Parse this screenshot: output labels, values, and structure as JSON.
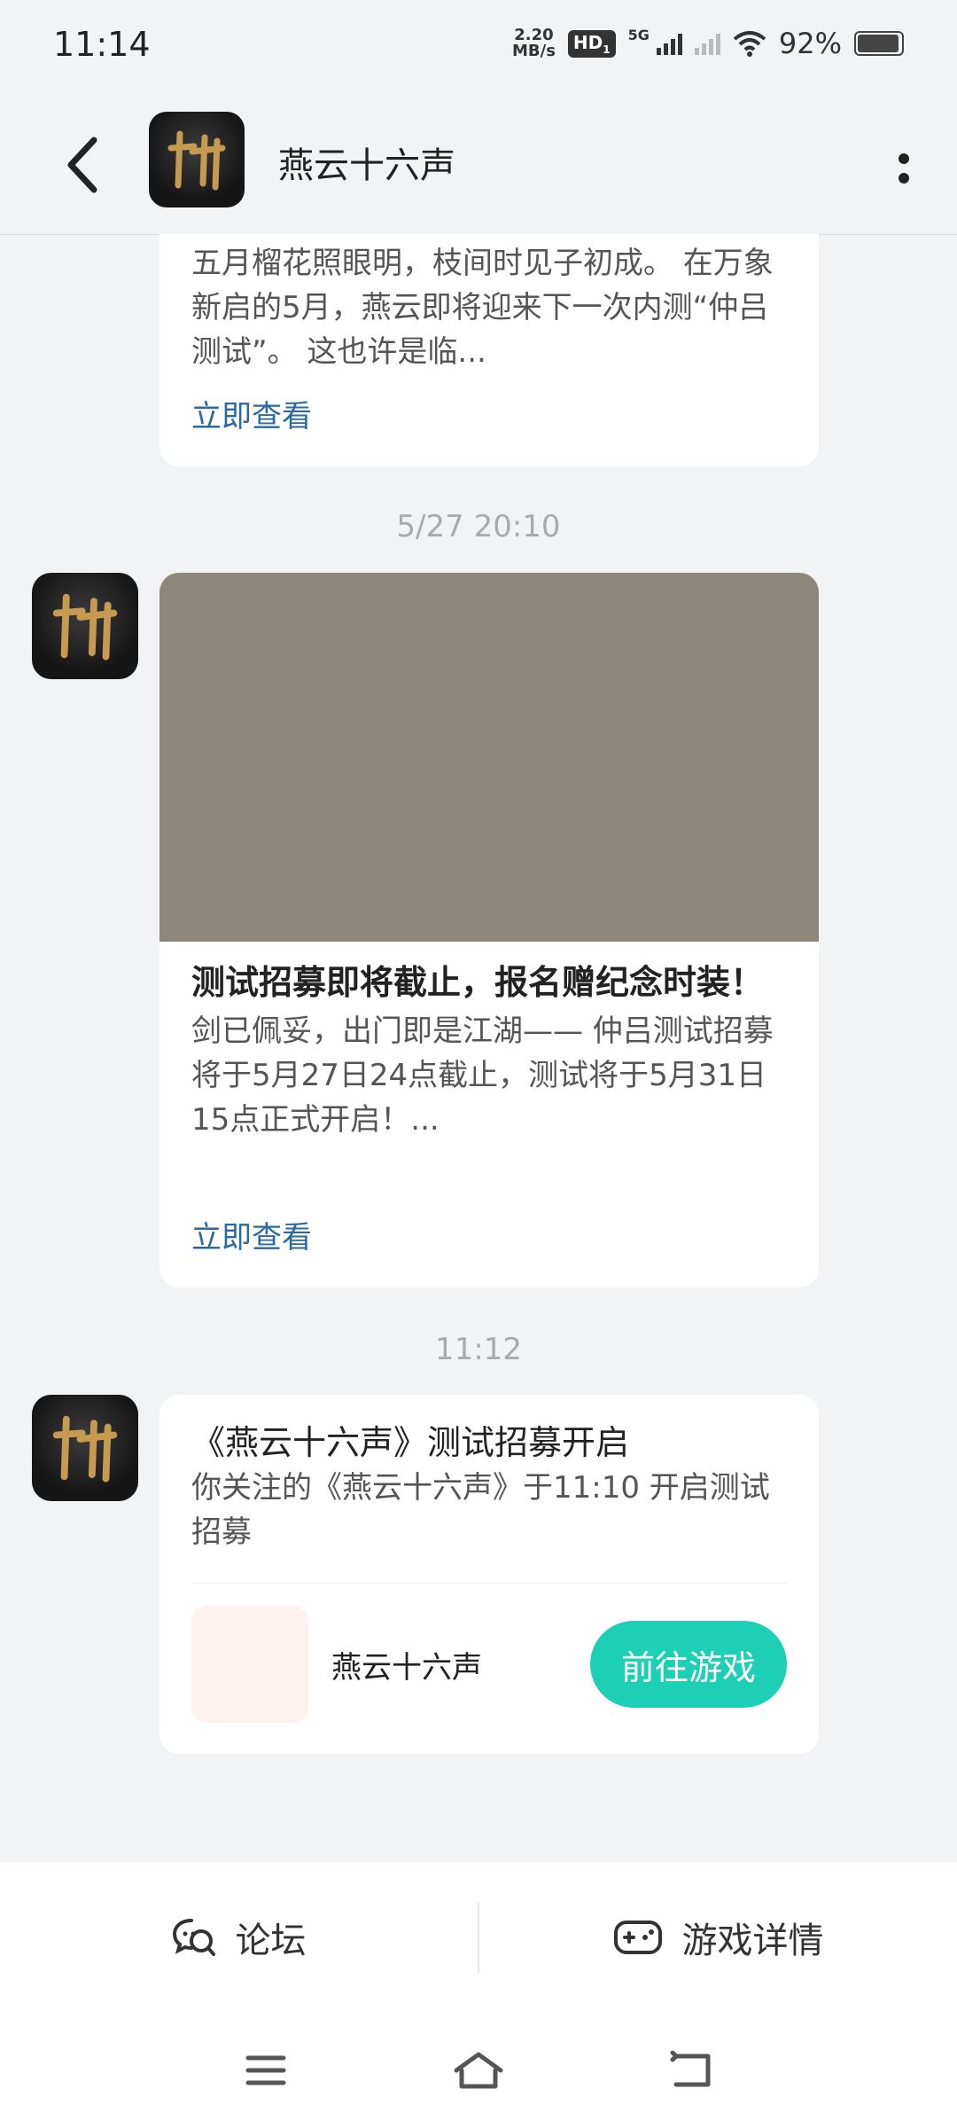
{
  "status_bar": {
    "time": "11:14",
    "net_speed_value": "2.20",
    "net_speed_unit": "MB/s",
    "hd_label": "HD",
    "hd_sub": "1",
    "network": "5G",
    "battery_percent": "92%"
  },
  "header": {
    "title": "燕云十六声"
  },
  "messages": [
    {
      "body": "五月榴花照眼明，枝间时见子初成。 在万象新启的5月，燕云即将迎来下一次内测“仲吕测试”。 这也许是临...",
      "link": "立即查看"
    },
    {
      "timestamp": "5/27  20:10",
      "title": "测试招募即将截止，报名赠纪念时装！",
      "body": "剑已佩妥，出门即是江湖—— 仲吕测试招募将于5月27日24点截止，测试将于5月31日15点正式开启！...",
      "link": "立即查看"
    },
    {
      "timestamp": "11:12",
      "title": "《燕云十六声》测试招募开启",
      "body": "你关注的《燕云十六声》于11:10 开启测试招募",
      "game_name": "燕云十六声",
      "button": "前往游戏"
    }
  ],
  "tabs": {
    "forum": "论坛",
    "game_detail": "游戏详情"
  },
  "colors": {
    "accent": "#1ccfb5",
    "link": "#2a6aa0",
    "banner": "#8c867b",
    "background": "#f2f3f5"
  },
  "icons": [
    "back-arrow-icon",
    "more-vertical-icon",
    "app-logo-icon",
    "forum-chat-icon",
    "gamepad-icon",
    "menu-icon",
    "home-icon",
    "back-icon"
  ]
}
